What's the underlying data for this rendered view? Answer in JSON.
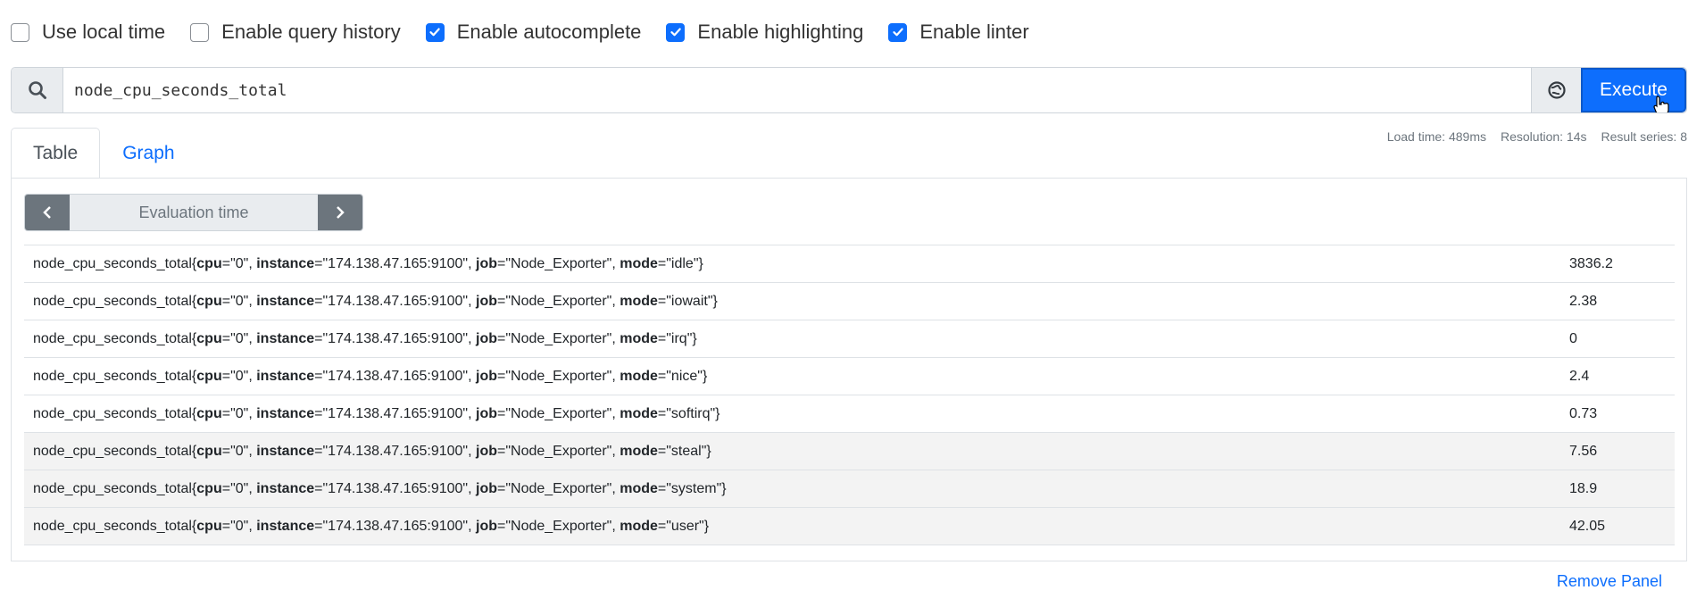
{
  "options": [
    {
      "label": "Use local time",
      "checked": false
    },
    {
      "label": "Enable query history",
      "checked": false
    },
    {
      "label": "Enable autocomplete",
      "checked": true
    },
    {
      "label": "Enable highlighting",
      "checked": true
    },
    {
      "label": "Enable linter",
      "checked": true
    }
  ],
  "query": {
    "value": "node_cpu_seconds_total",
    "execute_label": "Execute"
  },
  "stats": {
    "load_time": "Load time: 489ms",
    "resolution": "Resolution: 14s",
    "result_series": "Result series: 8"
  },
  "tabs": [
    {
      "label": "Table",
      "active": true
    },
    {
      "label": "Graph",
      "active": false
    }
  ],
  "evaluation": {
    "placeholder": "Evaluation time"
  },
  "results": [
    {
      "metric": "node_cpu_seconds_total",
      "cpu": "\"0\"",
      "instance": "\"174.138.47.165:9100\"",
      "job": "\"Node_Exporter\"",
      "mode": "\"idle\"",
      "value": "3836.2"
    },
    {
      "metric": "node_cpu_seconds_total",
      "cpu": "\"0\"",
      "instance": "\"174.138.47.165:9100\"",
      "job": "\"Node_Exporter\"",
      "mode": "\"iowait\"",
      "value": "2.38"
    },
    {
      "metric": "node_cpu_seconds_total",
      "cpu": "\"0\"",
      "instance": "\"174.138.47.165:9100\"",
      "job": "\"Node_Exporter\"",
      "mode": "\"irq\"",
      "value": "0"
    },
    {
      "metric": "node_cpu_seconds_total",
      "cpu": "\"0\"",
      "instance": "\"174.138.47.165:9100\"",
      "job": "\"Node_Exporter\"",
      "mode": "\"nice\"",
      "value": "2.4"
    },
    {
      "metric": "node_cpu_seconds_total",
      "cpu": "\"0\"",
      "instance": "\"174.138.47.165:9100\"",
      "job": "\"Node_Exporter\"",
      "mode": "\"softirq\"",
      "value": "0.73"
    },
    {
      "metric": "node_cpu_seconds_total",
      "cpu": "\"0\"",
      "instance": "\"174.138.47.165:9100\"",
      "job": "\"Node_Exporter\"",
      "mode": "\"steal\"",
      "value": "7.56"
    },
    {
      "metric": "node_cpu_seconds_total",
      "cpu": "\"0\"",
      "instance": "\"174.138.47.165:9100\"",
      "job": "\"Node_Exporter\"",
      "mode": "\"system\"",
      "value": "18.9"
    },
    {
      "metric": "node_cpu_seconds_total",
      "cpu": "\"0\"",
      "instance": "\"174.138.47.165:9100\"",
      "job": "\"Node_Exporter\"",
      "mode": "\"user\"",
      "value": "42.05"
    }
  ],
  "label_keys": {
    "cpu": "cpu",
    "instance": "instance",
    "job": "job",
    "mode": "mode"
  },
  "remove_panel": "Remove Panel",
  "colors": {
    "accent": "#0d6efd",
    "muted": "#6c757d"
  }
}
